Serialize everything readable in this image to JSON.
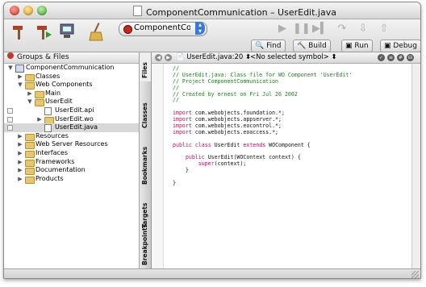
{
  "window": {
    "title": "ComponentCommunication – UserEdit.java"
  },
  "toolbar": {
    "target": "ComponentCommu",
    "icons": [
      "build-hammer-icon",
      "build-run-icon",
      "build-clean-icon",
      "broom-icon"
    ],
    "debug_icons": [
      "play-icon",
      "pause-icon",
      "step-continue-icon",
      "step-over-icon",
      "step-into-icon",
      "step-out-icon"
    ],
    "tabs": {
      "find": "Find",
      "build": "Build",
      "run": "Run",
      "debug": "Debug"
    }
  },
  "groups": {
    "header": "Groups & Files",
    "tree": [
      {
        "label": "ComponentCommunication",
        "level": 0,
        "kind": "project",
        "open": true
      },
      {
        "label": "Classes",
        "level": 1,
        "kind": "folder",
        "open": false
      },
      {
        "label": "Web Components",
        "level": 1,
        "kind": "folder",
        "open": true
      },
      {
        "label": "Main",
        "level": 2,
        "kind": "folder",
        "open": false
      },
      {
        "label": "UserEdit",
        "level": 2,
        "kind": "folder",
        "open": true
      },
      {
        "label": "UserEdit.api",
        "level": 3,
        "kind": "file",
        "check": true
      },
      {
        "label": "UserEdit.wo",
        "level": 3,
        "kind": "folder",
        "open": false,
        "check": true
      },
      {
        "label": "UserEdit.java",
        "level": 3,
        "kind": "file",
        "check": true,
        "selected": true
      },
      {
        "label": "Resources",
        "level": 1,
        "kind": "folder",
        "open": false
      },
      {
        "label": "Web Server Resources",
        "level": 1,
        "kind": "folder",
        "open": false
      },
      {
        "label": "Interfaces",
        "level": 1,
        "kind": "folder",
        "open": false
      },
      {
        "label": "Frameworks",
        "level": 1,
        "kind": "folder",
        "open": false
      },
      {
        "label": "Documentation",
        "level": 1,
        "kind": "folder",
        "open": false
      },
      {
        "label": "Products",
        "level": 1,
        "kind": "folder",
        "open": false
      }
    ]
  },
  "drawer_tabs": [
    "Files",
    "Classes",
    "Bookmarks",
    "Targets",
    "Breakpoints"
  ],
  "editor": {
    "file_label": "UserEdit.java:20",
    "symbol_label": "<No selected symbol>",
    "lines": [
      {
        "t": "//",
        "s": "c"
      },
      {
        "t": "// UserEdit.java: Class file for WO Component 'UserEdit'",
        "s": "c"
      },
      {
        "t": "// Project ComponentCommunication",
        "s": "c"
      },
      {
        "t": "//",
        "s": "c"
      },
      {
        "t": "// Created by ernest on Fri Jul 26 2002",
        "s": "c"
      },
      {
        "t": "//",
        "s": "c"
      },
      {
        "t": "",
        "s": ""
      },
      {
        "t": "import com.webobjects.foundation.*;",
        "s": "imp"
      },
      {
        "t": "import com.webobjects.appserver.*;",
        "s": "imp"
      },
      {
        "t": "import com.webobjects.eocontrol.*;",
        "s": "imp"
      },
      {
        "t": "import com.webobjects.eoaccess.*;",
        "s": "imp"
      },
      {
        "t": "",
        "s": ""
      },
      {
        "t": "public class UserEdit extends WOComponent {",
        "s": "cls"
      },
      {
        "t": "",
        "s": ""
      },
      {
        "t": "    public UserEdit(WOContext context) {",
        "s": "ctor"
      },
      {
        "t": "        super(context);",
        "s": "sup"
      },
      {
        "t": "    }",
        "s": ""
      },
      {
        "t": "",
        "s": ""
      },
      {
        "t": "}",
        "s": ""
      }
    ]
  },
  "colors": {
    "comment": "#1f7f1f",
    "keyword": "#b0126b",
    "selection": "#d8d8d8"
  }
}
